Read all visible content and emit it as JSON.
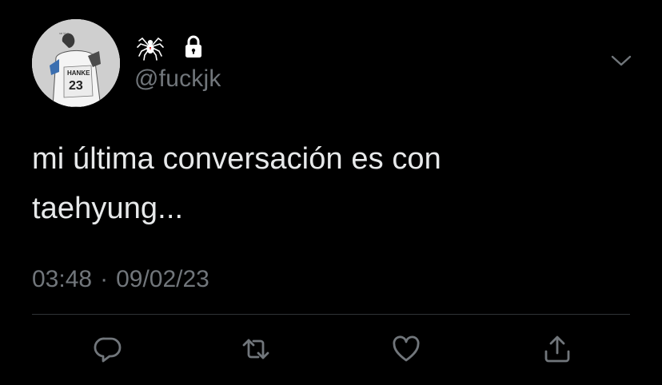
{
  "tweet": {
    "display_name_icons": [
      "spider-icon",
      "lock-icon"
    ],
    "handle": "@fuckjk",
    "text": "mi última conversación es con\ntaehyung...",
    "time": "03:48",
    "separator": "·",
    "date": "09/02/23"
  },
  "actions": {
    "reply_icon": "reply-icon",
    "retweet_icon": "retweet-icon",
    "like_icon": "heart-icon",
    "share_icon": "share-icon"
  },
  "colors": {
    "background": "#000000",
    "text_primary": "#e7e9ea",
    "text_secondary": "#71767b",
    "divider": "#2f3336"
  }
}
